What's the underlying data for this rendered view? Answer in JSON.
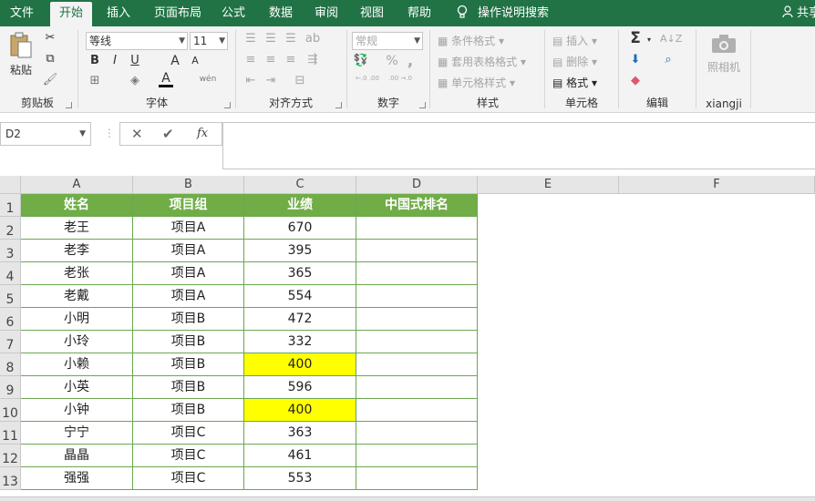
{
  "tabs": [
    "文件",
    "开始",
    "插入",
    "页面布局",
    "公式",
    "数据",
    "审阅",
    "视图",
    "帮助"
  ],
  "tell_me": "操作说明搜索",
  "share": "共享",
  "ribbon": {
    "clipboard": {
      "label": "剪贴板",
      "paste": "粘贴"
    },
    "font": {
      "label": "字体",
      "name": "等线",
      "size": "11",
      "bold": "B",
      "italic": "I",
      "underline": "U",
      "grow": "A",
      "shrink": "A",
      "fontcolor": "A",
      "wen": "wén"
    },
    "align": {
      "label": "对齐方式"
    },
    "number": {
      "label": "数字",
      "format": "常规",
      "percent": "%",
      "comma": ",",
      "inc": "←.0 .00",
      "dec": ".00 →.0"
    },
    "styles": {
      "label": "样式",
      "cond": "条件格式",
      "table": "套用表格格式",
      "cell": "单元格样式"
    },
    "cells": {
      "label": "单元格",
      "insert": "插入",
      "delete": "删除",
      "format": "格式"
    },
    "editing": {
      "label": "编辑",
      "sum": "Σ"
    },
    "camera": {
      "label": "xiangji",
      "btn": "照相机"
    }
  },
  "namebox": "D2",
  "fx": "fx",
  "columns": [
    "A",
    "B",
    "C",
    "D",
    "E",
    "F"
  ],
  "rows": [
    "1",
    "2",
    "3",
    "4",
    "5",
    "6",
    "7",
    "8",
    "9",
    "10",
    "11",
    "12",
    "13"
  ],
  "table": {
    "headers": [
      "姓名",
      "项目组",
      "业绩",
      "中国式排名"
    ],
    "data": [
      [
        "老王",
        "项目A",
        "670",
        ""
      ],
      [
        "老李",
        "项目A",
        "395",
        ""
      ],
      [
        "老张",
        "项目A",
        "365",
        ""
      ],
      [
        "老戴",
        "项目A",
        "554",
        ""
      ],
      [
        "小明",
        "项目B",
        "472",
        ""
      ],
      [
        "小玲",
        "项目B",
        "332",
        ""
      ],
      [
        "小赖",
        "项目B",
        "400",
        ""
      ],
      [
        "小英",
        "项目B",
        "596",
        ""
      ],
      [
        "小钟",
        "项目B",
        "400",
        ""
      ],
      [
        "宁宁",
        "项目C",
        "363",
        ""
      ],
      [
        "晶晶",
        "项目C",
        "461",
        ""
      ],
      [
        "强强",
        "项目C",
        "553",
        ""
      ]
    ]
  },
  "colors": {
    "accent": "#217346",
    "header_fill": "#70ad47",
    "highlight": "#ffff00"
  }
}
